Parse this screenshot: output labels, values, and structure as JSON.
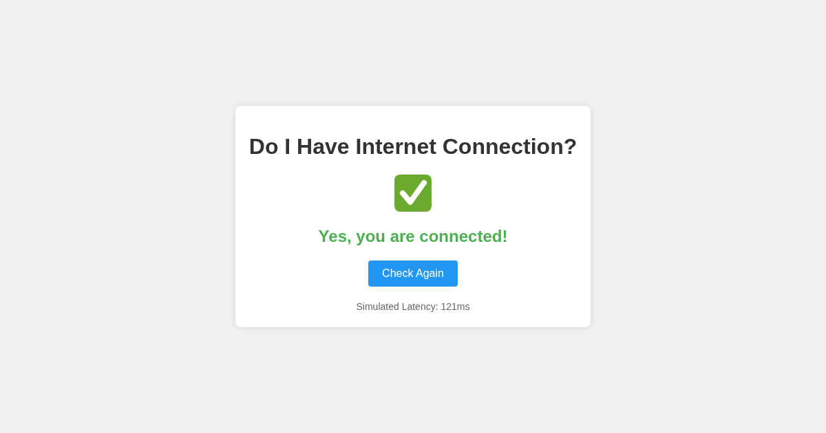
{
  "title": "Do I Have Internet Connection?",
  "status": {
    "connected": true,
    "text": "Yes, you are connected!"
  },
  "button": {
    "label": "Check Again"
  },
  "latency": "Simulated Latency: 121ms"
}
